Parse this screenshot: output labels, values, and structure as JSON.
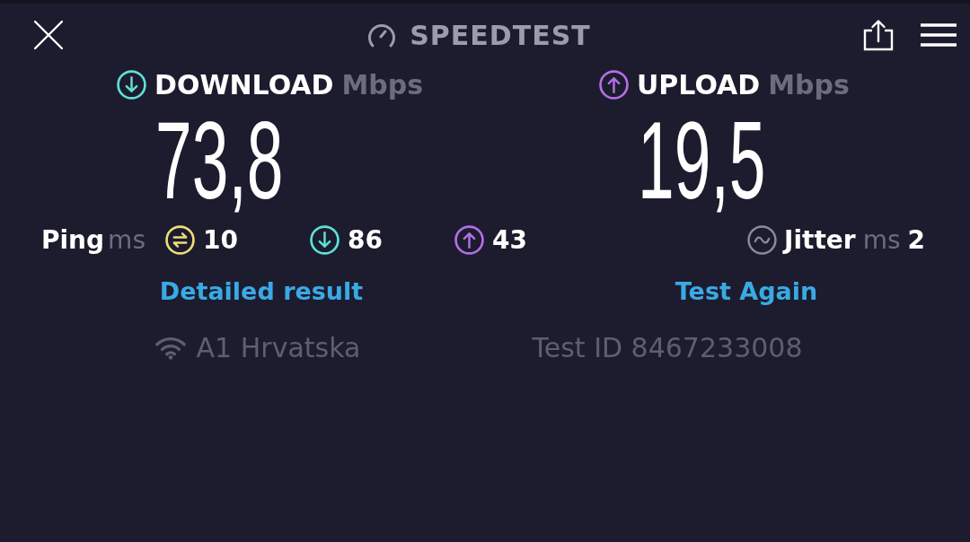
{
  "top_bar": {
    "title": "SPEEDTEST"
  },
  "results": [
    {
      "kind": "download",
      "label": "DOWNLOAD",
      "unit": "Mbps",
      "value": "73,8",
      "color": "#5fe0d6"
    },
    {
      "kind": "upload",
      "label": "UPLOAD",
      "unit": "Mbps",
      "value": "19,5",
      "color": "#b36ee6"
    }
  ],
  "ping": {
    "label": "Ping",
    "unit": "ms",
    "metrics": [
      {
        "kind": "idle",
        "value": "10",
        "color": "#ecdc78"
      },
      {
        "kind": "download",
        "value": "86",
        "color": "#5fe0d6"
      },
      {
        "kind": "upload",
        "value": "43",
        "color": "#b36ee6"
      }
    ]
  },
  "jitter": {
    "label": "Jitter",
    "unit": "ms",
    "value": "2"
  },
  "actions": [
    "Detailed result",
    "Test Again"
  ],
  "provider": "A1 Hrvatska",
  "test_id": "Test ID 8467233008"
}
